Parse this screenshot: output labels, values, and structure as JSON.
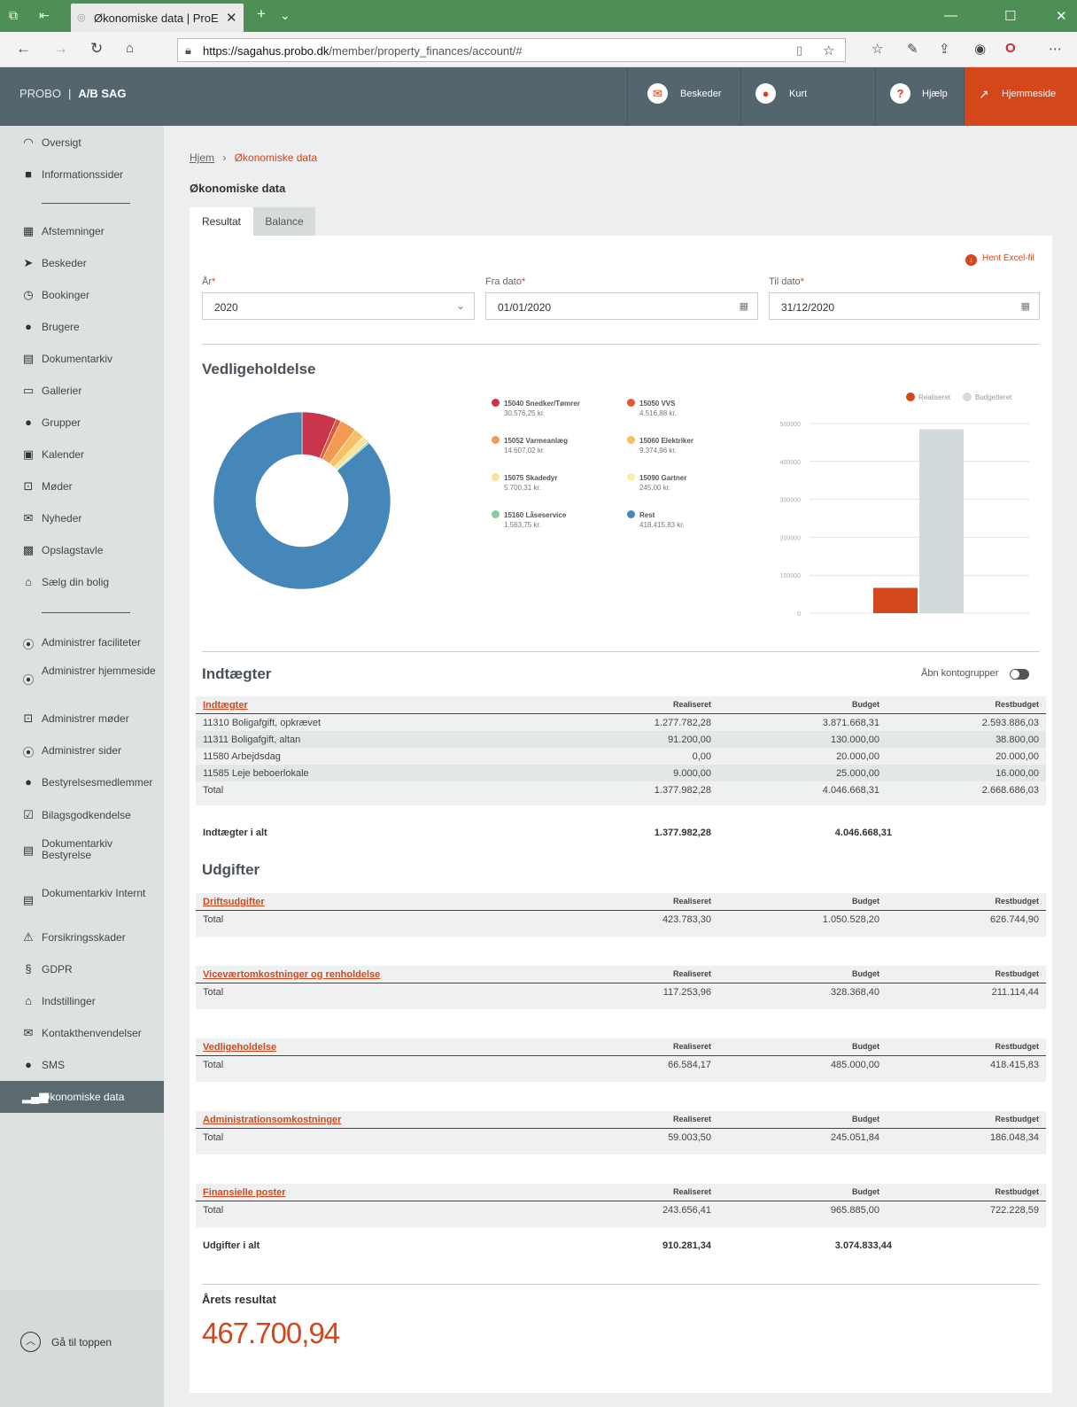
{
  "browser": {
    "tab_title": "Økonomiske data | ProE",
    "url_host": "https://sagahus.probo.dk",
    "url_path": "/member/property_finances/account/#"
  },
  "header": {
    "brand": "PROBO",
    "org": "A/B SAG",
    "messages": "Beskeder",
    "user": "Kurt",
    "help": "Hjælp",
    "homepage": "Hjemmeside"
  },
  "sidebar": {
    "items": [
      {
        "label": "Oversigt",
        "icon": "gauge-icon"
      },
      {
        "label": "Informationssider",
        "icon": "book-icon"
      },
      {
        "label": "Afstemninger",
        "icon": "ballot-icon"
      },
      {
        "label": "Beskeder",
        "icon": "paper-plane-icon"
      },
      {
        "label": "Bookinger",
        "icon": "clock-icon"
      },
      {
        "label": "Brugere",
        "icon": "user-icon"
      },
      {
        "label": "Dokumentarkiv",
        "icon": "archive-icon"
      },
      {
        "label": "Gallerier",
        "icon": "gallery-icon"
      },
      {
        "label": "Grupper",
        "icon": "group-icon"
      },
      {
        "label": "Kalender",
        "icon": "calendar-icon"
      },
      {
        "label": "Møder",
        "icon": "meeting-icon"
      },
      {
        "label": "Nyheder",
        "icon": "envelope-icon"
      },
      {
        "label": "Opslagstavle",
        "icon": "board-icon"
      },
      {
        "label": "Sælg din bolig",
        "icon": "house-icon"
      },
      {
        "label": "Administrer faciliteter",
        "icon": "admin-circle-icon"
      },
      {
        "label": "Administrer hjemmeside",
        "icon": "admin-circle-icon"
      },
      {
        "label": "Administrer møder",
        "icon": "meeting-icon"
      },
      {
        "label": "Administrer sider",
        "icon": "admin-circle-icon"
      },
      {
        "label": "Bestyrelsesmedlemmer",
        "icon": "user-icon"
      },
      {
        "label": "Bilagsgodkendelse",
        "icon": "checkbox-icon"
      },
      {
        "label": "Dokumentarkiv Bestyrelse",
        "icon": "archive-icon"
      },
      {
        "label": "Dokumentarkiv Internt",
        "icon": "archive-icon"
      },
      {
        "label": "Forsikringsskader",
        "icon": "warning-icon"
      },
      {
        "label": "GDPR",
        "icon": "section-icon"
      },
      {
        "label": "Indstillinger",
        "icon": "house-icon"
      },
      {
        "label": "Kontakthenvendelser",
        "icon": "envelope-icon"
      },
      {
        "label": "SMS",
        "icon": "chat-bubble-icon"
      },
      {
        "label": "Økonomiske data",
        "icon": "bar-chart-icon"
      }
    ],
    "goto_top": "Gå til toppen"
  },
  "breadcrumb": {
    "home": "Hjem",
    "current": "Økonomiske data"
  },
  "page_title": "Økonomiske data",
  "tabs": {
    "result": "Resultat",
    "balance": "Balance"
  },
  "excel_label": "Hent Excel-fil",
  "filters": {
    "year_label": "År",
    "year_value": "2020",
    "from_label": "Fra dato",
    "from_value": "01/01/2020",
    "to_label": "Til dato",
    "to_value": "31/12/2020"
  },
  "vedligehold": {
    "title": "Vedligeholdelse",
    "legend": [
      {
        "name": "15040 Snedker/Tømrer",
        "value": "30.576,25 kr.",
        "color": "#c9354a"
      },
      {
        "name": "15050 VVS",
        "value": "4.516,88 kr.",
        "color": "#e05636"
      },
      {
        "name": "15052 Varmeanlæg",
        "value": "14.607,02 kr.",
        "color": "#f39a52"
      },
      {
        "name": "15060 Elektriker",
        "value": "9.374,96 kr.",
        "color": "#f7c065"
      },
      {
        "name": "15075 Skadedyr",
        "value": "5.700,31 kr.",
        "color": "#fae29a"
      },
      {
        "name": "15090 Gartner",
        "value": "245,00 kr.",
        "color": "#f9eea8"
      },
      {
        "name": "15160 Låseservice",
        "value": "1.563,75 kr.",
        "color": "#86cc9c"
      },
      {
        "name": "Rest",
        "value": "418.415,83 kr.",
        "color": "#4587b9"
      }
    ]
  },
  "chart_data": [
    {
      "type": "pie",
      "categories": [
        "15040 Snedker/Tømrer",
        "15050 VVS",
        "15052 Varmeanlæg",
        "15060 Elektriker",
        "15075 Skadedyr",
        "15090 Gartner",
        "15160 Låseservice",
        "Rest"
      ],
      "values": [
        30576.25,
        4516.88,
        14607.02,
        9374.96,
        5700.31,
        245.0,
        1563.75,
        418415.83
      ],
      "colors": [
        "#c9354a",
        "#e05636",
        "#f39a52",
        "#f7c065",
        "#fae29a",
        "#f9eea8",
        "#86cc9c",
        "#4587b9"
      ],
      "donut": true
    },
    {
      "type": "bar",
      "categories": [
        ""
      ],
      "series": [
        {
          "name": "Realiseret",
          "values": [
            66584.17
          ],
          "color": "#d4471a"
        },
        {
          "name": "Budgetteret",
          "values": [
            485000
          ],
          "color": "#d3dadd"
        }
      ],
      "ylim": [
        0,
        500000
      ],
      "yticks": [
        "0",
        "100000",
        "200000",
        "300000",
        "400000",
        "500000"
      ],
      "grid": true,
      "legend": "top-right"
    }
  ],
  "income": {
    "title": "Indtægter",
    "toggle_label": "Åbn kontogrupper",
    "header": [
      "Indtægter",
      "Realiseret",
      "Budget",
      "Restbudget"
    ],
    "rows": [
      [
        "11310 Boligafgift, opkrævet",
        "1.277.782,28",
        "3.871.668,31",
        "2.593.886,03"
      ],
      [
        "11311 Boligafgift, altan",
        "91.200,00",
        "130.000,00",
        "38.800,00"
      ],
      [
        "11580 Arbejdsdag",
        "0,00",
        "20.000,00",
        "20.000,00"
      ],
      [
        "11585 Leje beboerlokale",
        "9.000,00",
        "25.000,00",
        "16.000,00"
      ],
      [
        "Total",
        "1.377.982,28",
        "4.046.668,31",
        "2.668.686,03"
      ]
    ],
    "sum": [
      "Indtægter i alt",
      "1.377.982,28",
      "4.046.668,31"
    ]
  },
  "expenses": {
    "title": "Udgifter",
    "groups": [
      {
        "name": "Driftsudgifter",
        "cols": [
          "Realiseret",
          "Budget",
          "Restbudget"
        ],
        "total": [
          "Total",
          "423.783,30",
          "1.050.528,20",
          "626.744,90"
        ]
      },
      {
        "name": "Viceværtomkostninger og renholdelse",
        "cols": [
          "Realiseret",
          "Budget",
          "Restbudget"
        ],
        "total": [
          "Total",
          "117.253,96",
          "328.368,40",
          "211.114,44"
        ]
      },
      {
        "name": "Vedligeholdelse",
        "cols": [
          "Realiseret",
          "Budget",
          "Restbudget"
        ],
        "total": [
          "Total",
          "66.584,17",
          "485.000,00",
          "418.415,83"
        ]
      },
      {
        "name": "Administrationsomkostninger",
        "cols": [
          "Realiseret",
          "Budget",
          "Restbudget"
        ],
        "total": [
          "Total",
          "59.003,50",
          "245.051,84",
          "186.048,34"
        ]
      },
      {
        "name": "Finansielle poster",
        "cols": [
          "Realiseret",
          "Budget",
          "Restbudget"
        ],
        "total": [
          "Total",
          "243.656,41",
          "965.885,00",
          "722.228,59"
        ]
      }
    ],
    "sum": [
      "Udgifter i alt",
      "910.281,34",
      "3.074.833,44"
    ]
  },
  "result": {
    "title": "Årets resultat",
    "value": "467.700,94"
  }
}
